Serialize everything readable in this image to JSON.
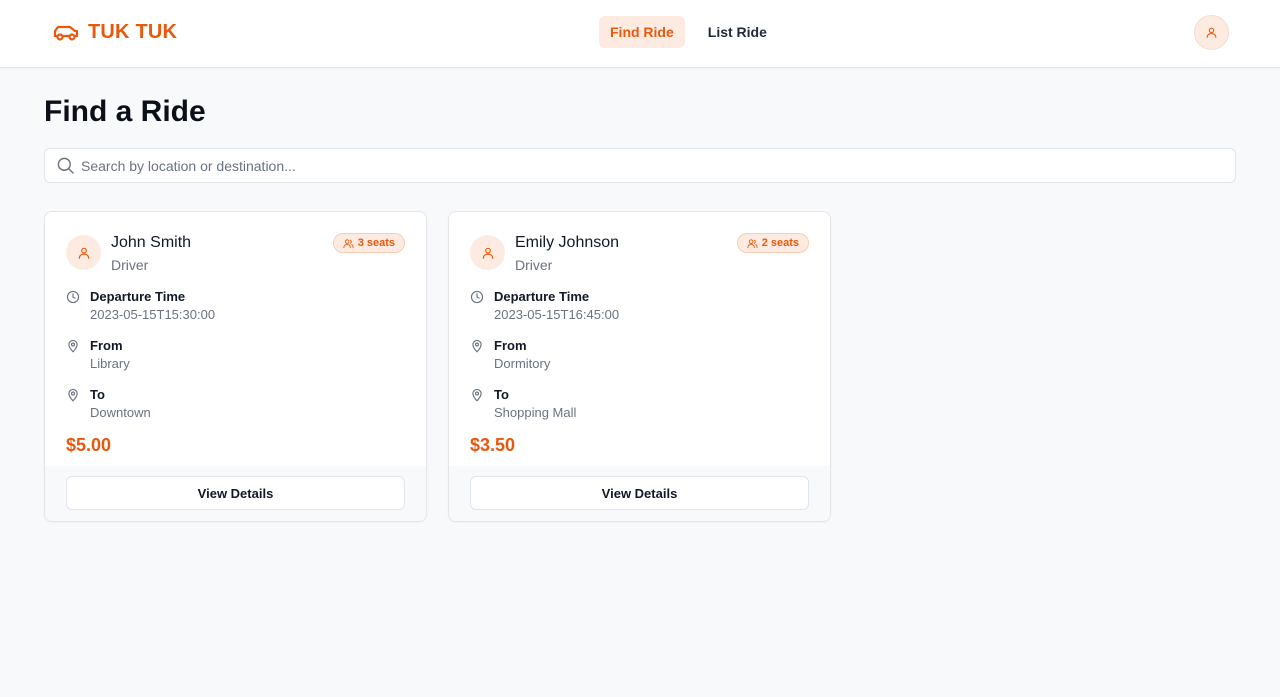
{
  "colors": {
    "accent": "#ea580c",
    "accent_light": "#fdebe1",
    "muted_text": "#6b7280",
    "background": "#f8f9fb"
  },
  "header": {
    "brand_name": "TUK TUK",
    "brand_icon": "car-icon",
    "nav": [
      {
        "label": "Find Ride",
        "active": true
      },
      {
        "label": "List Ride",
        "active": false
      }
    ],
    "profile_icon": "user-icon"
  },
  "main": {
    "title": "Find a Ride",
    "search": {
      "placeholder": "Search by location or destination...",
      "value": "",
      "icon": "search-icon"
    },
    "rides": [
      {
        "driver_name": "John Smith",
        "driver_role": "Driver",
        "seats": "3 seats",
        "departure_label": "Departure Time",
        "departure_value": "2023-05-15T15:30:00",
        "from_label": "From",
        "from_value": "Library",
        "to_label": "To",
        "to_value": "Downtown",
        "price": "$5.00",
        "button_label": "View Details"
      },
      {
        "driver_name": "Emily Johnson",
        "driver_role": "Driver",
        "seats": "2 seats",
        "departure_label": "Departure Time",
        "departure_value": "2023-05-15T16:45:00",
        "from_label": "From",
        "from_value": "Dormitory",
        "to_label": "To",
        "to_value": "Shopping Mall",
        "price": "$3.50",
        "button_label": "View Details"
      }
    ]
  }
}
